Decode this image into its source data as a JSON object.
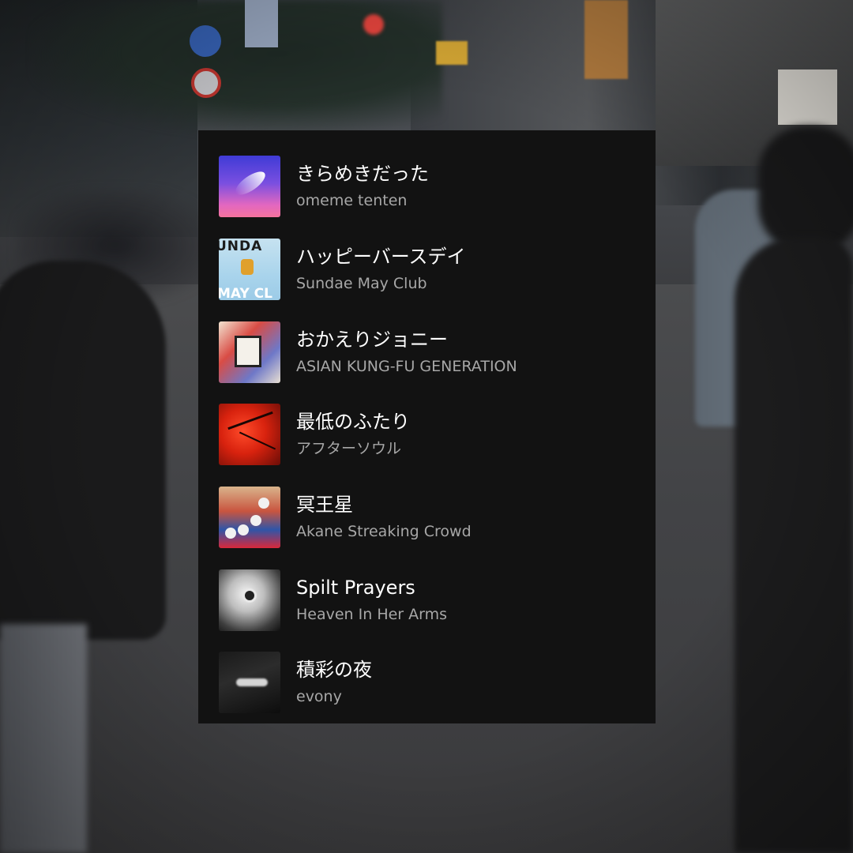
{
  "playlist": {
    "tracks": [
      {
        "title": "きらめきだった",
        "artist": "omeme tenten"
      },
      {
        "title": "ハッピーバースデイ",
        "artist": "Sundae May Club",
        "cover_text_top": "UNDA",
        "cover_text_bottom": "MAY CL"
      },
      {
        "title": "おかえりジョニー",
        "artist": "ASIAN KUNG-FU GENERATION"
      },
      {
        "title": "最低のふたり",
        "artist": "アフターソウル"
      },
      {
        "title": "冥王星",
        "artist": "Akane Streaking Crowd"
      },
      {
        "title": "Spilt Prayers",
        "artist": "Heaven In Her Arms"
      },
      {
        "title": "積彩の夜",
        "artist": "evony"
      }
    ]
  },
  "colors": {
    "card_background": "#121212",
    "title_text": "#ffffff",
    "artist_text": "#a7a7a7"
  }
}
